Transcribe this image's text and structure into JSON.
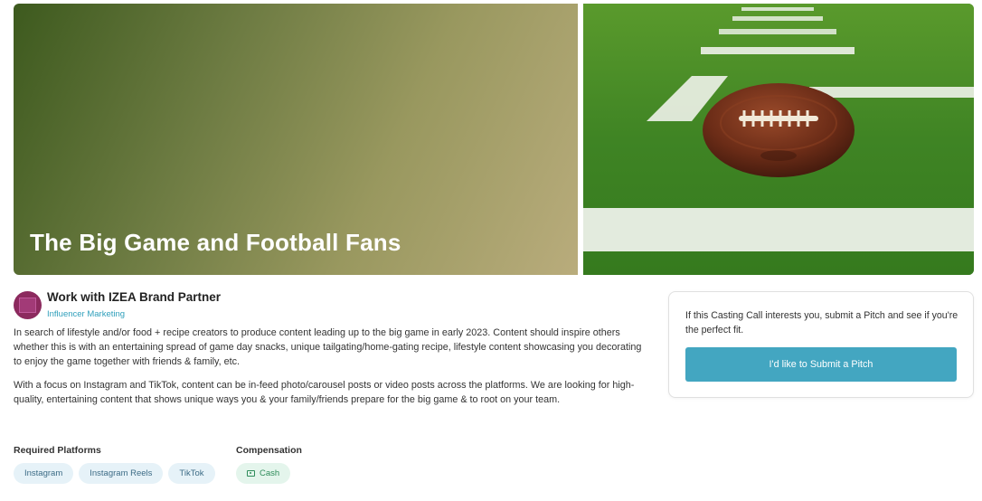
{
  "hero": {
    "title": "The Big Game and Football Fans",
    "image_icon": "football-on-field-photo"
  },
  "brand": {
    "name": "Work with IZEA Brand Partner",
    "category": "Influencer Marketing",
    "avatar_color": "#8c2a5e"
  },
  "description": {
    "paragraphs": [
      "In search of lifestyle and/or food + recipe creators to produce content leading up to the big game in early 2023. Content should inspire others whether this is with an entertaining spread of game day snacks, unique tailgating/home-gating recipe, lifestyle content showcasing you decorating to enjoy the game together with friends & family, etc.",
      "With a focus on Instagram and TikTok, content can be in-feed photo/carousel posts or video posts across the platforms. We are looking for high-quality, entertaining content that shows unique ways you & your family/friends prepare for the big game & to root on your team."
    ]
  },
  "requirements": {
    "platforms_label": "Required Platforms",
    "platforms": [
      "Instagram",
      "Instagram Reels",
      "TikTok"
    ],
    "compensation_label": "Compensation",
    "compensation": "Cash",
    "compensation_icon": "cash-icon"
  },
  "pitch": {
    "text": "If this Casting Call interests you, submit a Pitch and see if you're the perfect fit.",
    "button_label": "I'd like to Submit a Pitch",
    "accent_color": "#43a6c1"
  }
}
